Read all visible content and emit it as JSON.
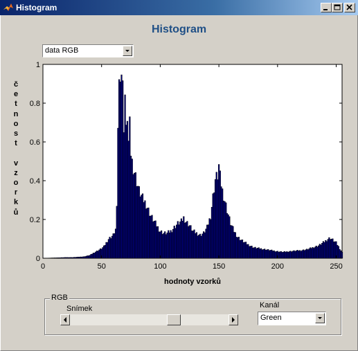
{
  "window": {
    "title": "Histogram"
  },
  "figure_title": "Histogram",
  "data_select": {
    "value": "data RGB"
  },
  "rgb_panel": {
    "title": "RGB",
    "frame_label": "Snímek",
    "frame_slider_fraction": 0.67,
    "channel_label": "Kanál",
    "channel_value": "Green"
  },
  "icons": [
    "matlab-logo-icon",
    "minimize-icon",
    "maximize-icon",
    "close-icon",
    "chevron-down-icon",
    "arrow-left-icon",
    "arrow-right-icon"
  ],
  "chart_data": {
    "type": "bar",
    "xlabel": "hodnoty vzorků",
    "ylabel_letters": [
      "č",
      "e",
      "t",
      "n",
      "o",
      "s",
      "t",
      "",
      "v",
      "z",
      "o",
      "r",
      "k",
      "ů"
    ],
    "xlim": [
      0,
      255
    ],
    "ylim": [
      0,
      1
    ],
    "xticks": [
      "0",
      "50",
      "100",
      "150",
      "200",
      "250"
    ],
    "yticks": [
      "0",
      "0.2",
      "0.4",
      "0.6",
      "0.8",
      "1"
    ],
    "bar_color": "#00007f",
    "points": [
      [
        0,
        0
      ],
      [
        10,
        0.002
      ],
      [
        20,
        0.004
      ],
      [
        25,
        0.004
      ],
      [
        30,
        0.006
      ],
      [
        35,
        0.008
      ],
      [
        40,
        0.015
      ],
      [
        44,
        0.03
      ],
      [
        47,
        0.04
      ],
      [
        50,
        0.05
      ],
      [
        52,
        0.06
      ],
      [
        54,
        0.08
      ],
      [
        56,
        0.1
      ],
      [
        58,
        0.11
      ],
      [
        60,
        0.12
      ],
      [
        62,
        0.15
      ],
      [
        63,
        0.25
      ],
      [
        64,
        0.7
      ],
      [
        65,
        0.9
      ],
      [
        66,
        1.0
      ],
      [
        67,
        0.97
      ],
      [
        68,
        0.88
      ],
      [
        69,
        0.7
      ],
      [
        70,
        0.85
      ],
      [
        71,
        0.65
      ],
      [
        72,
        0.75
      ],
      [
        73,
        0.6
      ],
      [
        74,
        0.68
      ],
      [
        75,
        0.55
      ],
      [
        76,
        0.5
      ],
      [
        78,
        0.45
      ],
      [
        80,
        0.4
      ],
      [
        82,
        0.35
      ],
      [
        85,
        0.31
      ],
      [
        88,
        0.28
      ],
      [
        90,
        0.25
      ],
      [
        92,
        0.22
      ],
      [
        95,
        0.19
      ],
      [
        98,
        0.16
      ],
      [
        100,
        0.14
      ],
      [
        103,
        0.13
      ],
      [
        106,
        0.13
      ],
      [
        109,
        0.14
      ],
      [
        112,
        0.16
      ],
      [
        115,
        0.18
      ],
      [
        118,
        0.19
      ],
      [
        120,
        0.21
      ],
      [
        122,
        0.19
      ],
      [
        125,
        0.17
      ],
      [
        128,
        0.14
      ],
      [
        131,
        0.13
      ],
      [
        134,
        0.12
      ],
      [
        137,
        0.13
      ],
      [
        140,
        0.16
      ],
      [
        143,
        0.22
      ],
      [
        145,
        0.32
      ],
      [
        147,
        0.41
      ],
      [
        149,
        0.43
      ],
      [
        150,
        0.48
      ],
      [
        151,
        0.42
      ],
      [
        153,
        0.35
      ],
      [
        155,
        0.3
      ],
      [
        157,
        0.25
      ],
      [
        160,
        0.18
      ],
      [
        163,
        0.14
      ],
      [
        166,
        0.11
      ],
      [
        170,
        0.09
      ],
      [
        175,
        0.07
      ],
      [
        180,
        0.055
      ],
      [
        185,
        0.05
      ],
      [
        190,
        0.045
      ],
      [
        195,
        0.04
      ],
      [
        200,
        0.035
      ],
      [
        205,
        0.032
      ],
      [
        210,
        0.035
      ],
      [
        215,
        0.038
      ],
      [
        220,
        0.04
      ],
      [
        225,
        0.045
      ],
      [
        230,
        0.055
      ],
      [
        235,
        0.065
      ],
      [
        240,
        0.085
      ],
      [
        243,
        0.1
      ],
      [
        245,
        0.105
      ],
      [
        247,
        0.095
      ],
      [
        250,
        0.08
      ],
      [
        253,
        0.05
      ],
      [
        255,
        0.03
      ]
    ]
  }
}
